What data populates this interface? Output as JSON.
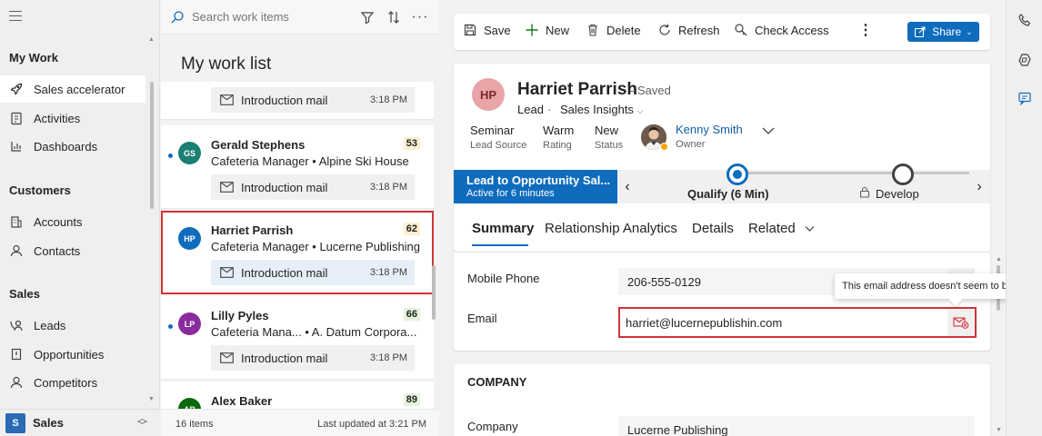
{
  "nav": {
    "groups": {
      "my_work": "My Work",
      "customers": "Customers",
      "sales": "Sales"
    },
    "items": [
      {
        "label": "Sales accelerator",
        "icon": "rocket-icon",
        "active": true
      },
      {
        "label": "Activities",
        "icon": "clipboard-icon"
      },
      {
        "label": "Dashboards",
        "icon": "dashboard-icon"
      },
      {
        "label": "Accounts",
        "icon": "building-icon"
      },
      {
        "label": "Contacts",
        "icon": "person-icon"
      },
      {
        "label": "Leads",
        "icon": "phone-person-icon"
      },
      {
        "label": "Opportunities",
        "icon": "document-icon"
      },
      {
        "label": "Competitors",
        "icon": "person-icon"
      }
    ],
    "area": {
      "badge": "S",
      "name": "Sales"
    }
  },
  "worklist": {
    "search_placeholder": "Search work items",
    "title": "My work list",
    "footer_count": "16 items",
    "footer_updated": "Last updated at 3:21 PM",
    "cards": [
      {
        "name": "",
        "subtitle": "",
        "score": "",
        "task": "Introduction mail",
        "time": "3:18 PM"
      },
      {
        "initials": "GS",
        "avatar_color": "#1a7f73",
        "name": "Gerald Stephens",
        "subtitle": "Cafeteria Manager • Alpine Ski House",
        "score": "53",
        "score_color": "#fcefd0",
        "task": "Introduction mail",
        "time": "3:18 PM"
      },
      {
        "initials": "HP",
        "avatar_color": "#0f6cbd",
        "name": "Harriet Parrish",
        "subtitle": "Cafeteria Manager • Lucerne Publishing",
        "score": "62",
        "score_color": "#fcefd0",
        "task": "Introduction mail",
        "time": "3:18 PM",
        "selected": true
      },
      {
        "initials": "LP",
        "avatar_color": "#8a2b9e",
        "name": "Lilly Pyles",
        "subtitle": "Cafeteria Mana... • A. Datum Corpora...",
        "score": "66",
        "score_color": "#e3f2d9",
        "task": "Introduction mail",
        "time": "3:18 PM"
      },
      {
        "initials": "AB",
        "avatar_color": "#0b6a0b",
        "name": "Alex Baker",
        "subtitle": "",
        "score": "89",
        "score_color": "#e3f2d9",
        "task": "",
        "time": ""
      }
    ]
  },
  "commands": {
    "save": "Save",
    "new": "New",
    "delete": "Delete",
    "refresh": "Refresh",
    "check_access": "Check Access",
    "share": "Share"
  },
  "record": {
    "initials": "HP",
    "name": "Harriet Parrish",
    "saved_status": "- Saved",
    "entity": "Lead",
    "separator": "·",
    "form": "Sales Insights",
    "fields": [
      {
        "value": "Seminar",
        "label": "Lead Source"
      },
      {
        "value": "Warm",
        "label": "Rating"
      },
      {
        "value": "New",
        "label": "Status"
      }
    ],
    "owner": {
      "name": "Kenny Smith",
      "label": "Owner"
    },
    "bpf": {
      "title": "Lead to Opportunity Sal...",
      "subtitle": "Active for 6 minutes",
      "stages": [
        {
          "label": "Qualify  (6 Min)",
          "active": true
        },
        {
          "label": "Develop"
        }
      ]
    },
    "tabs": [
      "Summary",
      "Relationship Analytics",
      "Details",
      "Related"
    ],
    "form_fields": {
      "mobile_label": "Mobile Phone",
      "mobile_value": "206-555-0129",
      "email_label": "Email",
      "email_value": "harriet@lucernepublishin.com"
    },
    "tooltip": "This email address doesn't seem to be valid.",
    "company_section": "COMPANY",
    "company_label": "Company",
    "company_value": "Lucerne Publishing"
  },
  "colors": {
    "accent": "#0f6cbd",
    "error": "#d13438"
  }
}
